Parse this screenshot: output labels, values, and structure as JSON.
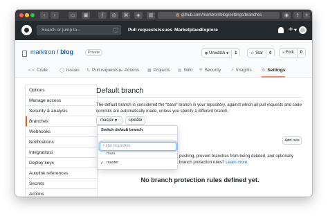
{
  "browser": {
    "url": "github.com/marktron/blog/settings/branches",
    "lock_icon": "lock-icon"
  },
  "header": {
    "search_placeholder": "Search or jump to...",
    "search_key": "/",
    "nav": [
      "Pull requests",
      "Issues",
      "Marketplace",
      "Explore"
    ],
    "plus": "+"
  },
  "repo": {
    "owner": "marktron",
    "separator": "/",
    "name": "blog",
    "visibility": "Private",
    "unwatch_label": "Unwatch",
    "unwatch_count": "1",
    "star_label": "Star",
    "star_count": "0",
    "fork_label": "Fork",
    "fork_count": "0"
  },
  "tabs": [
    {
      "label": "Code",
      "icon": "<>"
    },
    {
      "label": "Issues",
      "icon": "◯"
    },
    {
      "label": "Pull requests",
      "icon": "⇅"
    },
    {
      "label": "Actions",
      "icon": "▶"
    },
    {
      "label": "Projects",
      "icon": "▦"
    },
    {
      "label": "Wiki",
      "icon": "▤"
    },
    {
      "label": "Security",
      "icon": "⛨"
    },
    {
      "label": "Insights",
      "icon": "↗"
    },
    {
      "label": "Settings",
      "icon": "⚙"
    }
  ],
  "sidebar": {
    "items": [
      "Options",
      "Manage access",
      "Security & analysis",
      "Branches",
      "Webhooks",
      "Notifications",
      "Integrations",
      "Deploy keys",
      "Autolink references",
      "Secrets",
      "Actions"
    ],
    "active": "Branches"
  },
  "main": {
    "title": "Default branch",
    "description": "The default branch is considered the “base” branch in your repository, against which all pull requests and code commits are automatically made, unless you specify a different branch.",
    "branch_button": "master",
    "update_button": "Update",
    "add_rule_button": "Add rule",
    "protection_text": "pushing, prevent branches from being deleted, and optionally",
    "protection_text2": "branch protection rules?",
    "learn_more": "Learn more.",
    "no_rules": "No branch protection rules defined yet."
  },
  "dropdown": {
    "title": "Switch default branch",
    "filter_placeholder": "Filter branches",
    "branches": [
      {
        "name": "main",
        "selected": false
      },
      {
        "name": "master",
        "selected": true
      }
    ],
    "check": "✓"
  }
}
